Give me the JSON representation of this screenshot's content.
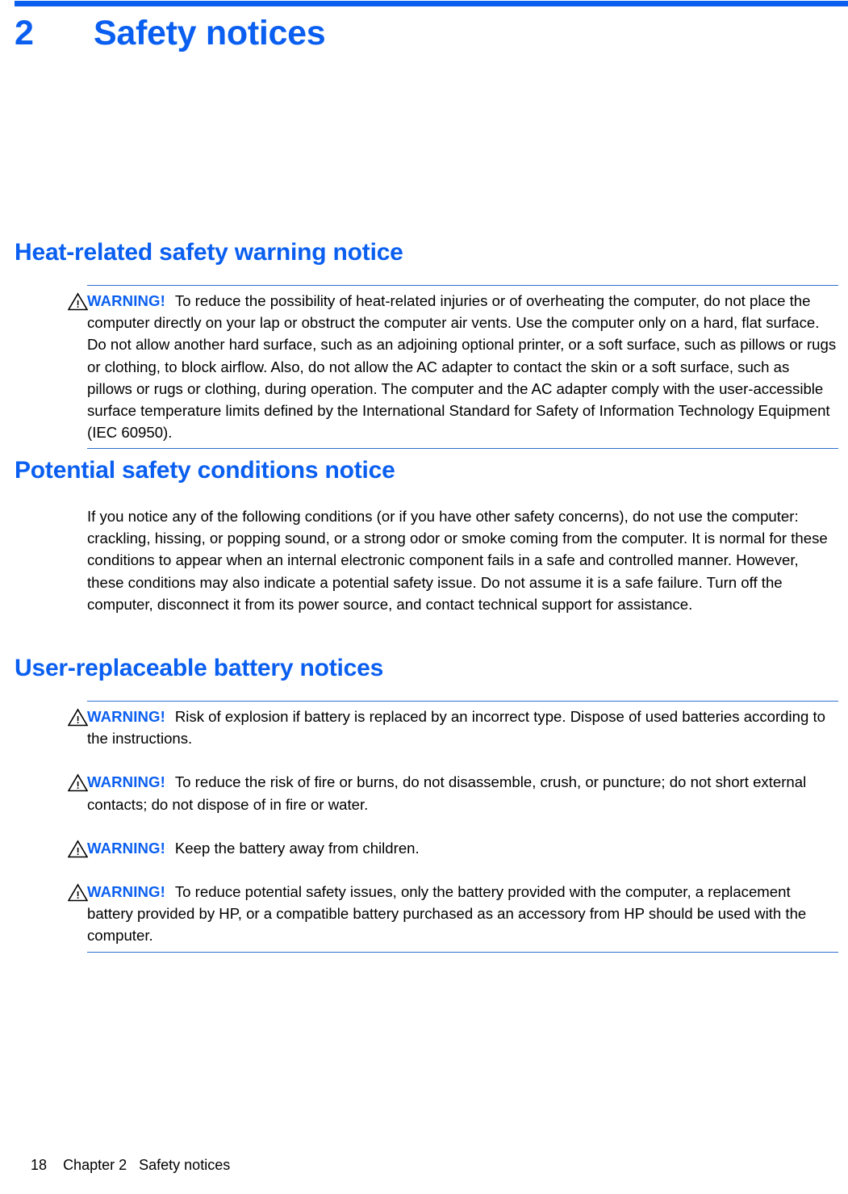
{
  "document": {
    "chapter_number": "2",
    "chapter_title": "Safety notices",
    "accent_color": "#0a5ff0",
    "rule_color": "#2e6fd0",
    "text_color": "#000000",
    "warning_label": "WARNING!"
  },
  "sections": [
    {
      "heading": "Heat-related safety warning notice",
      "notes": [
        {
          "label": "WARNING!",
          "text": "To reduce the possibility of heat-related injuries or of overheating the computer, do not place the computer directly on your lap or obstruct the computer air vents. Use the computer only on a hard, flat surface. Do not allow another hard surface, such as an adjoining optional printer, or a soft surface, such as pillows or rugs or clothing, to block airflow. Also, do not allow the AC adapter to contact the skin or a soft surface, such as pillows or rugs or clothing, during operation. The computer and the AC adapter comply with the user-accessible surface temperature limits defined by the International Standard for Safety of Information Technology Equipment (IEC 60950)."
        }
      ]
    },
    {
      "heading": "Potential safety conditions notice",
      "paragraph": "If you notice any of the following conditions (or if you have other safety concerns), do not use the computer: crackling, hissing, or popping sound, or a strong odor or smoke coming from the computer. It is normal for these conditions to appear when an internal electronic component fails in a safe and controlled manner. However, these conditions may also indicate a potential safety issue. Do not assume it is a safe failure. Turn off the computer, disconnect it from its power source, and contact technical support for assistance."
    },
    {
      "heading": "User-replaceable battery notices",
      "notes": [
        {
          "label": "WARNING!",
          "text": "Risk of explosion if battery is replaced by an incorrect type. Dispose of used batteries according to the instructions."
        },
        {
          "label": "WARNING!",
          "text": "To reduce the risk of fire or burns, do not disassemble, crush, or puncture; do not short external contacts; do not dispose of in fire or water."
        },
        {
          "label": "WARNING!",
          "text": "Keep the battery away from children."
        },
        {
          "label": "WARNING!",
          "text": "To reduce potential safety issues, only the battery provided with the computer, a replacement battery provided by HP, or a compatible battery purchased as an accessory from HP should be used with the computer."
        }
      ]
    }
  ],
  "footer": {
    "page_number": "18",
    "chapter_ref": "Chapter 2",
    "chapter_name": "Safety notices"
  }
}
